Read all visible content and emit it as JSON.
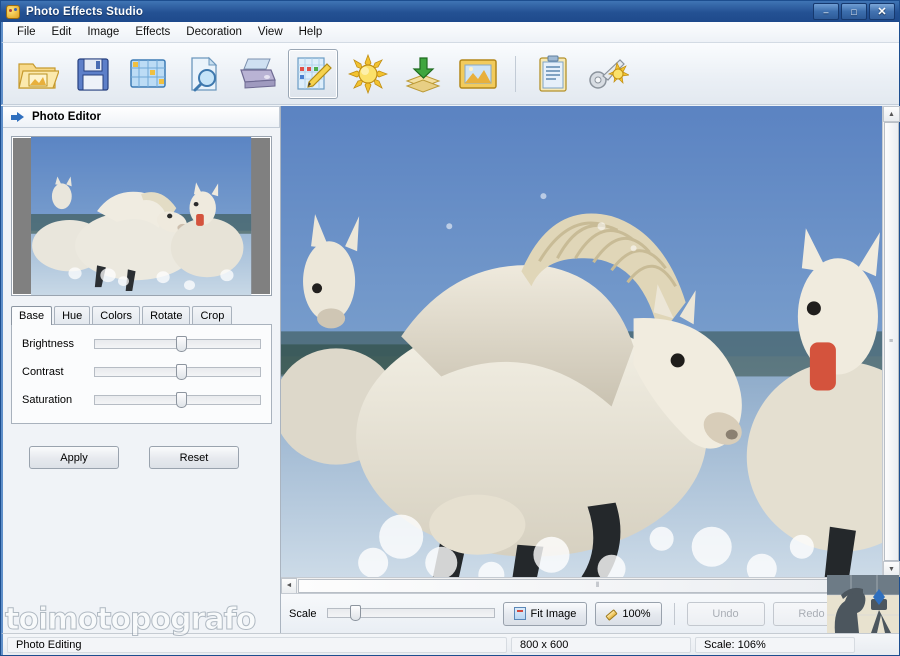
{
  "window": {
    "title": "Photo Effects Studio",
    "icon": "palette-icon",
    "controls": {
      "minimize": "–",
      "maximize": "□",
      "close": "✕"
    }
  },
  "menubar": {
    "items": [
      {
        "label": "File"
      },
      {
        "label": "Edit"
      },
      {
        "label": "Image"
      },
      {
        "label": "Effects"
      },
      {
        "label": "Decoration"
      },
      {
        "label": "View"
      },
      {
        "label": "Help"
      }
    ]
  },
  "toolbar": {
    "buttons": [
      {
        "name": "open-file-icon",
        "title": "Open"
      },
      {
        "name": "save-file-icon",
        "title": "Save"
      },
      {
        "name": "thumbnails-grid-icon",
        "title": "Browse"
      },
      {
        "name": "preview-magnifier-icon",
        "title": "Preview"
      },
      {
        "name": "print-icon",
        "title": "Print"
      },
      {
        "name": "photo-editor-icon",
        "title": "Photo Editor",
        "active": true
      },
      {
        "name": "effects-sun-icon",
        "title": "Effects"
      },
      {
        "name": "decoration-layers-icon",
        "title": "Decoration"
      },
      {
        "name": "frame-image-icon",
        "title": "Frames"
      },
      {
        "name": "clipboard-list-icon",
        "title": "Batch"
      },
      {
        "name": "key-settings-icon",
        "title": "Options"
      }
    ]
  },
  "sidebar": {
    "panel_title": "Photo Editor",
    "panel_icon": "blue-arrow-icon",
    "tabs": [
      {
        "label": "Base",
        "active": true
      },
      {
        "label": "Hue",
        "active": false
      },
      {
        "label": "Colors",
        "active": false
      },
      {
        "label": "Rotate",
        "active": false
      },
      {
        "label": "Crop",
        "active": false
      }
    ],
    "sliders": [
      {
        "label": "Brightness",
        "value": 50
      },
      {
        "label": "Contrast",
        "value": 50
      },
      {
        "label": "Saturation",
        "value": 50
      }
    ],
    "buttons": {
      "apply": "Apply",
      "reset": "Reset"
    }
  },
  "controlbar": {
    "scale_label": "Scale",
    "scale_value": 15,
    "fit_image": "Fit Image",
    "zoom_100": "100%",
    "undo": "Undo",
    "redo": "Redo",
    "undo_enabled": false,
    "redo_enabled": false
  },
  "statusbar": {
    "message": "Photo Editing",
    "dimensions": "800 x 600",
    "scale": "Scale: 106%"
  },
  "watermark": {
    "text": "toimotopografo",
    "logo": "surveyor-silhouette-icon"
  },
  "scrollbars": {
    "vertical_grip": "≡",
    "horizontal_grip": "⦀",
    "up": "▲",
    "down": "▼",
    "left": "◄",
    "right": "►"
  },
  "colors": {
    "title_bar": "#245193",
    "accent": "#2f6fbe",
    "canvas_bg": "#6f86a8",
    "sky": "#5d86c0",
    "horse": "#e8e4d8"
  }
}
